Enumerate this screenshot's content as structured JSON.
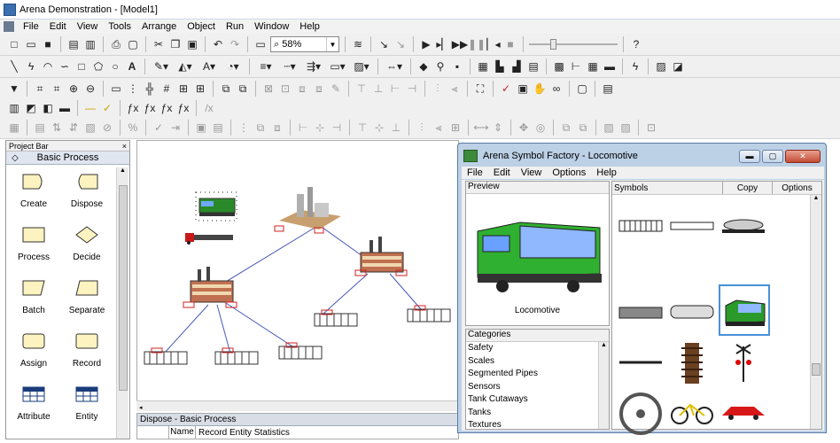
{
  "app": {
    "title": "Arena Demonstration - [Model1]",
    "menu": [
      "File",
      "Edit",
      "View",
      "Tools",
      "Arrange",
      "Object",
      "Run",
      "Window",
      "Help"
    ],
    "zoom": "58%"
  },
  "project_bar": {
    "title": "Project Bar",
    "close": "×",
    "group": "Basic Process",
    "modules": [
      {
        "label": "Create"
      },
      {
        "label": "Dispose"
      },
      {
        "label": "Process"
      },
      {
        "label": "Decide"
      },
      {
        "label": "Batch"
      },
      {
        "label": "Separate"
      },
      {
        "label": "Assign"
      },
      {
        "label": "Record"
      },
      {
        "label": "Attribute"
      },
      {
        "label": "Entity"
      }
    ]
  },
  "spreadsheet": {
    "title": "Dispose - Basic Process",
    "col_name": "Name",
    "col_record": "Record Entity Statistics"
  },
  "symbol_factory": {
    "title": "Arena Symbol Factory - Locomotive",
    "menu": [
      "File",
      "Edit",
      "View",
      "Options",
      "Help"
    ],
    "preview_label": "Preview",
    "preview_caption": "Locomotive",
    "categories_label": "Categories",
    "categories": [
      "Safety",
      "Scales",
      "Segmented Pipes",
      "Sensors",
      "Tank Cutaways",
      "Tanks",
      "Textures"
    ],
    "symbols_label": "Symbols",
    "copy_button": "Copy",
    "options_button": "Options"
  }
}
